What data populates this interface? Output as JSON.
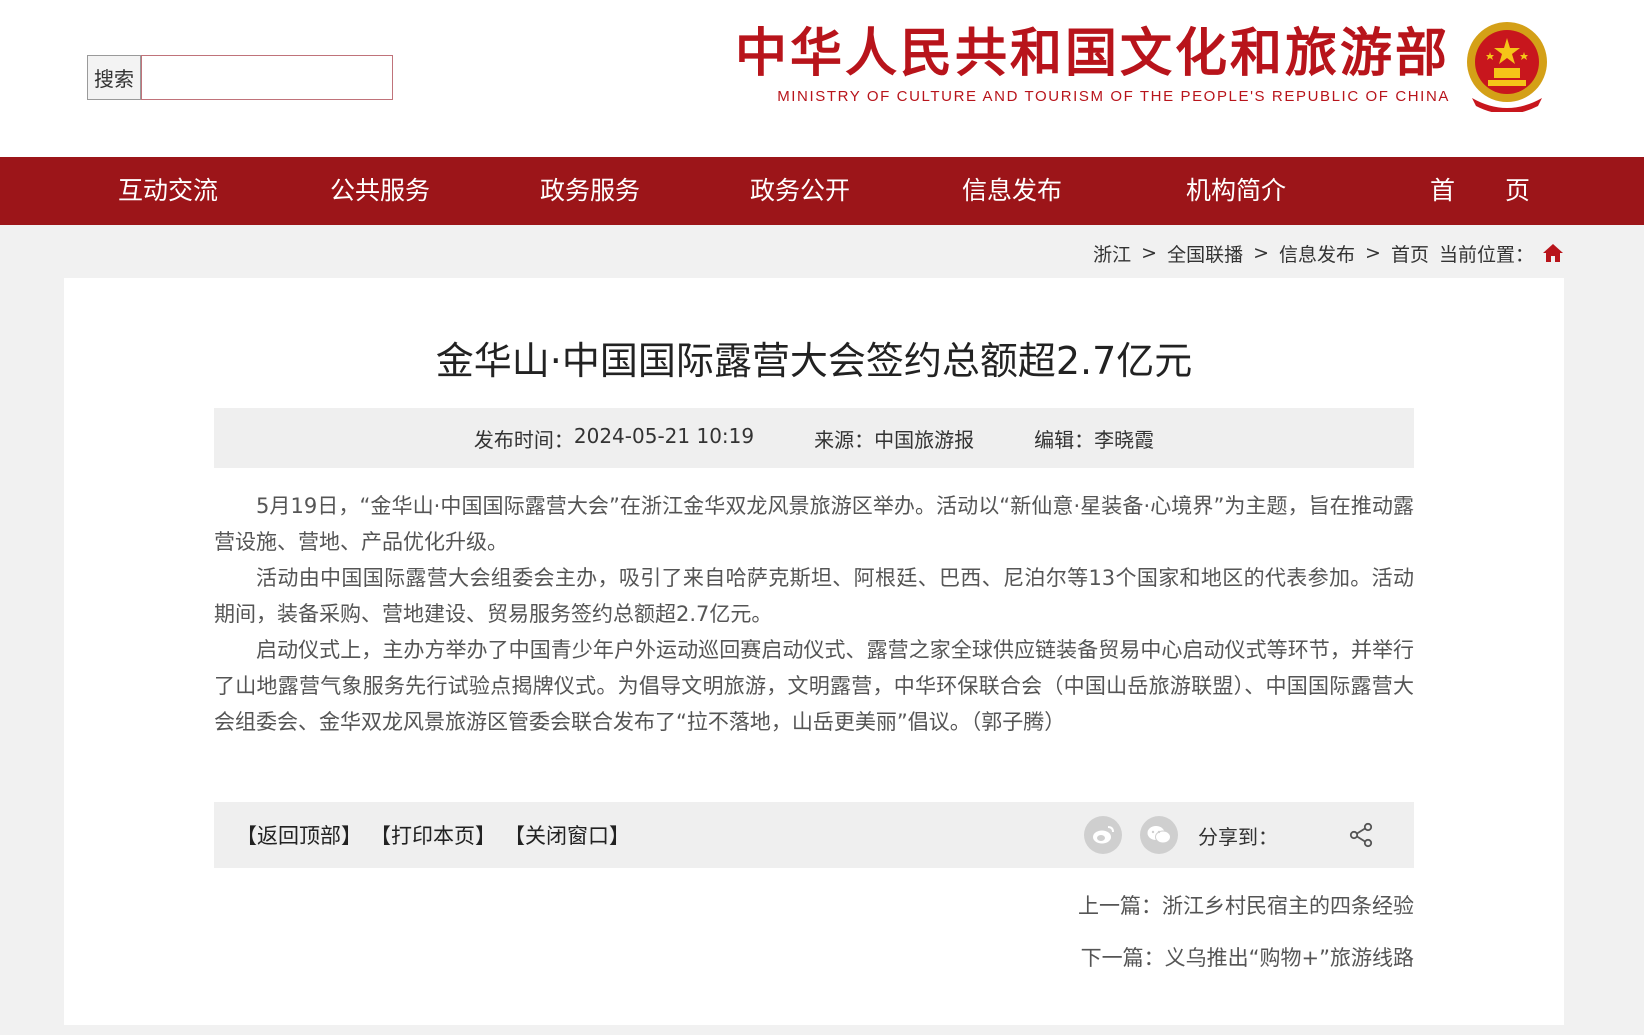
{
  "header": {
    "logo_cn": "中华人民共和国文化和旅游部",
    "logo_en": "MINISTRY OF CULTURE AND TOURISM OF THE PEOPLE'S REPUBLIC OF CHINA",
    "search_button": "搜索",
    "search_placeholder": ""
  },
  "nav": {
    "items": [
      {
        "label": "首　　页"
      },
      {
        "label": "机构简介"
      },
      {
        "label": "信息发布"
      },
      {
        "label": "政务公开"
      },
      {
        "label": "政务服务"
      },
      {
        "label": "公共服务"
      },
      {
        "label": "互动交流"
      }
    ]
  },
  "breadcrumb": {
    "prefix": "当前位置：",
    "items": [
      "首页",
      ">",
      "信息发布",
      ">",
      "全国联播",
      ">",
      "浙江"
    ]
  },
  "article": {
    "title": "金华山·中国国际露营大会签约总额超2.7亿元",
    "meta": {
      "date_label": "发布时间：",
      "date": "2024-05-21 10:19",
      "source_label": "来源：",
      "source": "中国旅游报",
      "editor_label": "编辑：",
      "editor": "李晓霞"
    },
    "paragraphs": [
      "5月19日，“金华山·中国国际露营大会”在浙江金华双龙风景旅游区举办。活动以“新仙意·星装备·心境界”为主题，旨在推动露营设施、营地、产品优化升级。",
      "活动由中国国际露营大会组委会主办，吸引了来自哈萨克斯坦、阿根廷、巴西、尼泊尔等13个国家和地区的代表参加。活动期间，装备采购、营地建设、贸易服务签约总额超2.7亿元。",
      "启动仪式上，主办方举办了中国青少年户外运动巡回赛启动仪式、露营之家全球供应链装备贸易中心启动仪式等环节，并举行了山地露营气象服务先行试验点揭牌仪式。为倡导文明旅游，文明露营，中华环保联合会（中国山岳旅游联盟）、中国国际露营大会组委会、金华双龙风景旅游区管委会联合发布了“拉不落地，山岳更美丽”倡议。（郭子腾）"
    ]
  },
  "toolbar": {
    "back_top": "【返回顶部】",
    "print": "【打印本页】",
    "close": "【关闭窗口】",
    "share_label": "分享到："
  },
  "prev_next": {
    "prev_label": "上一篇：",
    "prev_title": "浙江乡村民宿主的四条经验",
    "next_label": "下一篇：",
    "next_title": "义乌推出“购物+”旅游线路"
  },
  "colors": {
    "brand_red": "#9c1519",
    "logo_red": "#b8141b",
    "page_bg": "#f1f1f1"
  },
  "icons": [
    "national-emblem-icon",
    "home-icon",
    "share-icon",
    "wechat-icon",
    "weibo-icon"
  ]
}
